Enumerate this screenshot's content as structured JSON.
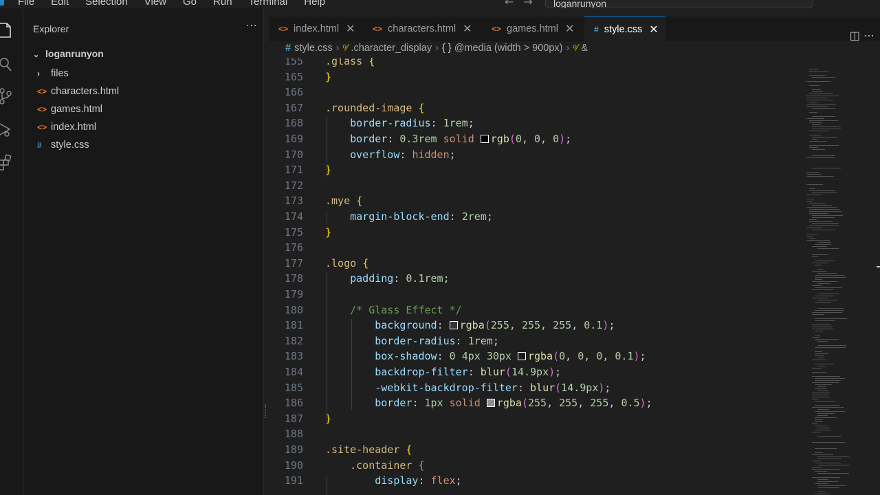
{
  "menu": [
    "File",
    "Edit",
    "Selection",
    "View",
    "Go",
    "Run",
    "Terminal",
    "Help"
  ],
  "nav": {
    "back": "←",
    "forward": "→"
  },
  "command_center": {
    "text": "loganrunyon"
  },
  "sidebar": {
    "title": "Explorer",
    "more": "···",
    "root": "loganrunyon",
    "items": [
      {
        "label": "files",
        "icon": "chevron-right-icon",
        "glyph": "›"
      },
      {
        "label": "characters.html",
        "icon": "html-file-icon",
        "glyph": "<>"
      },
      {
        "label": "games.html",
        "icon": "html-file-icon",
        "glyph": "<>"
      },
      {
        "label": "index.html",
        "icon": "html-file-icon",
        "glyph": "<>"
      },
      {
        "label": "style.css",
        "icon": "css-file-icon",
        "glyph": "#"
      }
    ]
  },
  "tabs": [
    {
      "label": "index.html",
      "glyph": "<>"
    },
    {
      "label": "characters.html",
      "glyph": "<>"
    },
    {
      "label": "games.html",
      "glyph": "<>"
    },
    {
      "label": "style.css",
      "glyph": "#",
      "active": true
    }
  ],
  "breadcrumb": [
    "style.css",
    ".character_display",
    "@media (width > 900px)",
    "&"
  ],
  "code": [
    {
      "n": "155",
      "t": ".glass {"
    },
    {
      "n": "165",
      "t": "}"
    },
    {
      "n": "166",
      "t": ""
    },
    {
      "n": "167",
      "t": ".rounded-image {"
    },
    {
      "n": "168",
      "t": "    border-radius: 1rem;"
    },
    {
      "n": "169",
      "t": "    border: 0.3rem solid rgb(0, 0, 0);"
    },
    {
      "n": "170",
      "t": "    overflow: hidden;"
    },
    {
      "n": "171",
      "t": "}"
    },
    {
      "n": "172",
      "t": ""
    },
    {
      "n": "173",
      "t": ".mye {"
    },
    {
      "n": "174",
      "t": "    margin-block-end: 2rem;"
    },
    {
      "n": "175",
      "t": "}"
    },
    {
      "n": "176",
      "t": ""
    },
    {
      "n": "177",
      "t": ".logo {"
    },
    {
      "n": "178",
      "t": "    padding: 0.1rem;"
    },
    {
      "n": "179",
      "t": ""
    },
    {
      "n": "180",
      "t": "    /* Glass Effect */"
    },
    {
      "n": "181",
      "t": "        background: rgba(255, 255, 255, 0.1);"
    },
    {
      "n": "182",
      "t": "        border-radius: 1rem;"
    },
    {
      "n": "183",
      "t": "        box-shadow: 0 4px 30px rgba(0, 0, 0, 0.1);"
    },
    {
      "n": "184",
      "t": "        backdrop-filter: blur(14.9px);"
    },
    {
      "n": "185",
      "t": "        -webkit-backdrop-filter: blur(14.9px);"
    },
    {
      "n": "186",
      "t": "        border: 1px solid rgba(255, 255, 255, 0.5);"
    },
    {
      "n": "187",
      "t": "}"
    },
    {
      "n": "188",
      "t": ""
    },
    {
      "n": "189",
      "t": ".site-header {"
    },
    {
      "n": "190",
      "t": "    .container {"
    },
    {
      "n": "191",
      "t": "        display: flex;"
    }
  ],
  "colors": {
    "accent": "#0078d4",
    "html_icon": "#e37933",
    "css_icon": "#519aba"
  }
}
